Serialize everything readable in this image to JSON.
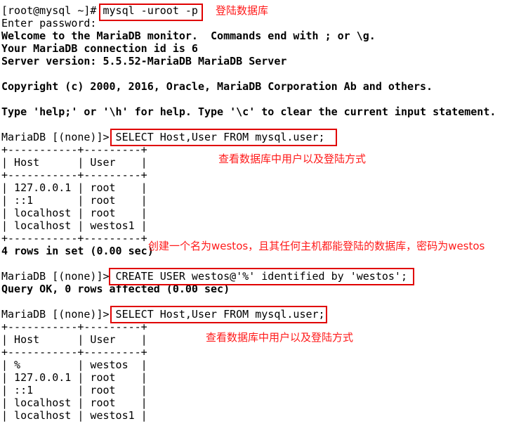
{
  "terminal": {
    "lines": [
      {
        "text": "[root@mysql ~]# mysql -uroot -p",
        "bold": false
      },
      {
        "text": "Enter password:",
        "bold": false
      },
      {
        "text": "Welcome to the MariaDB monitor.  Commands end with ; or \\g.",
        "bold": true
      },
      {
        "text": "Your MariaDB connection id is 6",
        "bold": true
      },
      {
        "text": "Server version: 5.5.52-MariaDB MariaDB Server",
        "bold": true
      },
      {
        "text": "",
        "bold": false
      },
      {
        "text": "Copyright (c) 2000, 2016, Oracle, MariaDB Corporation Ab and others.",
        "bold": true
      },
      {
        "text": "",
        "bold": false
      },
      {
        "text": "Type 'help;' or '\\h' for help. Type '\\c' to clear the current input statement.",
        "bold": true
      },
      {
        "text": "",
        "bold": false
      },
      {
        "text": "MariaDB [(none)]> SELECT Host,User FROM mysql.user;",
        "bold": false
      },
      {
        "text": "+-----------+---------+",
        "bold": false
      },
      {
        "text": "| Host      | User    |",
        "bold": false
      },
      {
        "text": "+-----------+---------+",
        "bold": false
      },
      {
        "text": "| 127.0.0.1 | root    |",
        "bold": false
      },
      {
        "text": "| ::1       | root    |",
        "bold": false
      },
      {
        "text": "| localhost | root    |",
        "bold": false
      },
      {
        "text": "| localhost | westos1 |",
        "bold": false
      },
      {
        "text": "+-----------+---------+",
        "bold": false
      },
      {
        "text": "4 rows in set (0.00 sec)",
        "bold": true
      },
      {
        "text": "",
        "bold": false
      },
      {
        "text": "MariaDB [(none)]> CREATE USER westos@'%' identified by 'westos';",
        "bold": false
      },
      {
        "text": "Query OK, 0 rows affected (0.00 sec)",
        "bold": true
      },
      {
        "text": "",
        "bold": false
      },
      {
        "text": "MariaDB [(none)]> SELECT Host,User FROM mysql.user;",
        "bold": false
      },
      {
        "text": "+-----------+---------+",
        "bold": false
      },
      {
        "text": "| Host      | User    |",
        "bold": false
      },
      {
        "text": "+-----------+---------+",
        "bold": false
      },
      {
        "text": "| %         | westos  |",
        "bold": false
      },
      {
        "text": "| 127.0.0.1 | root    |",
        "bold": false
      },
      {
        "text": "| ::1       | root    |",
        "bold": false
      },
      {
        "text": "| localhost | root    |",
        "bold": false
      },
      {
        "text": "| localhost | westos1 |",
        "bold": false
      }
    ]
  },
  "annotations": {
    "login": "登陆数据库",
    "view_users_1": "查看数据库中用户以及登陆方式",
    "create_user": "创建一个名为westos，且其任何主机都能登陆的数据库，密码为westos",
    "view_users_2": "查看数据库中用户以及登陆方式"
  },
  "colors": {
    "annotation": "#ff1a1a",
    "box": "#e00000"
  }
}
